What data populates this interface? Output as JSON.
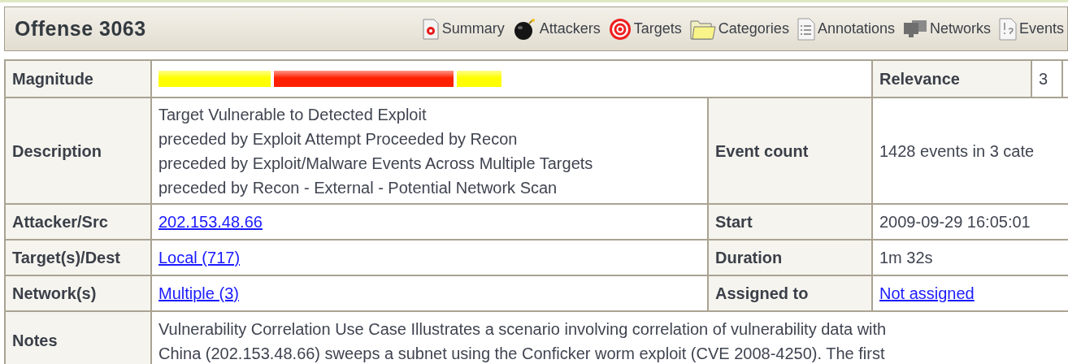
{
  "header": {
    "title": "Offense 3063",
    "nav": [
      {
        "kind": "summary",
        "label": "Summary"
      },
      {
        "kind": "attackers",
        "label": "Attackers"
      },
      {
        "kind": "targets",
        "label": "Targets"
      },
      {
        "kind": "categories",
        "label": "Categories"
      },
      {
        "kind": "annotations",
        "label": "Annotations"
      },
      {
        "kind": "networks",
        "label": "Networks"
      },
      {
        "kind": "events",
        "label": "Events"
      }
    ]
  },
  "magnitude": {
    "label": "Magnitude",
    "segments": [
      {
        "color": "#ffff00"
      },
      {
        "color": "#ff2000"
      },
      {
        "color": "#ffff00"
      }
    ]
  },
  "relevance": {
    "label": "Relevance",
    "value": "3"
  },
  "description": {
    "label": "Description",
    "lines": [
      "Target Vulnerable to Detected Exploit",
      "preceded by Exploit Attempt Proceeded by Recon",
      "preceded by Exploit/Malware Events Across Multiple Targets",
      "preceded by Recon - External - Potential Network Scan"
    ]
  },
  "event_count": {
    "label": "Event count",
    "value": "1428 events in 3 cate"
  },
  "rows": [
    {
      "label": "Attacker/Src",
      "value": "202.153.48.66",
      "link": true,
      "label_2": "Start",
      "value_2": "2009-09-29 16:05:01",
      "link_2": false
    },
    {
      "label": "Target(s)/Dest",
      "value": "Local (717)",
      "link": true,
      "label_2": "Duration",
      "value_2": "1m 32s",
      "link_2": false
    },
    {
      "label": "Network(s)",
      "value": "Multiple (3)",
      "link": true,
      "label_2": "Assigned to",
      "value_2": "Not assigned",
      "link_2": true
    }
  ],
  "notes": {
    "label": "Notes",
    "lines": [
      "Vulnerability Correlation Use Case Illustrates a scenario involving correlation of vulnerability data with",
      "China (202.153.48.66) sweeps a subnet using the Conficker worm exploit (CVE 2008-4250). The first"
    ]
  }
}
